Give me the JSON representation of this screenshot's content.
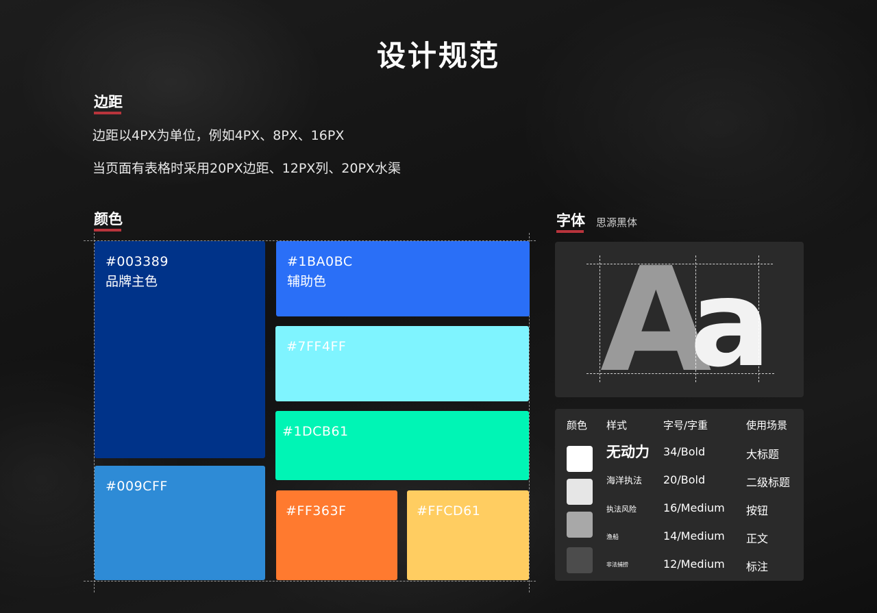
{
  "page": {
    "title": "设计规范"
  },
  "spacing": {
    "heading": "边距",
    "line1": "边距以4PX为单位，例如4PX、8PX、16PX",
    "line2": "当页面有表格时采用20PX边距、12PX列、20PX水渠"
  },
  "colors": {
    "heading": "颜色",
    "swatches": [
      {
        "hex": "#003389",
        "label": "品牌主色",
        "color": "#003389"
      },
      {
        "hex": "#1BA0BC",
        "label": "辅助色",
        "color": "#2a6ff7"
      },
      {
        "hex": "#7FF4FF",
        "color": "#7ff4ff"
      },
      {
        "hex": "#1DCB61",
        "color": "#00f5b5"
      },
      {
        "hex": "#009CFF",
        "color": "#2e8bd6"
      },
      {
        "hex": "#FF363F",
        "color": "#ff7a2f"
      },
      {
        "hex": "#FFCD61",
        "color": "#ffcd61"
      }
    ]
  },
  "typography": {
    "heading": "字体",
    "font_name": "思源黑体",
    "specimen_upper": "A",
    "specimen_lower": "a",
    "table": {
      "headers": [
        "颜色",
        "样式",
        "字号/字重",
        "使用场景"
      ],
      "rows": [
        {
          "swatch": "#ffffff",
          "style": "无动力",
          "size": "34/Bold",
          "usage": "大标题"
        },
        {
          "swatch": "#e6e6e6",
          "style": "海洋执法",
          "size": "20/Bold",
          "usage": "二级标题"
        },
        {
          "swatch": "#a8a8a8",
          "style": "执法风险",
          "size": "16/Medium",
          "usage": "按钮"
        },
        {
          "swatch": "#4c4c4c",
          "style": "渔船",
          "size": "14/Medium",
          "usage": "正文"
        },
        {
          "swatch": "#4c4c4c",
          "style": "非法捕捞",
          "size": "12/Medium",
          "usage": "标注"
        }
      ]
    }
  }
}
